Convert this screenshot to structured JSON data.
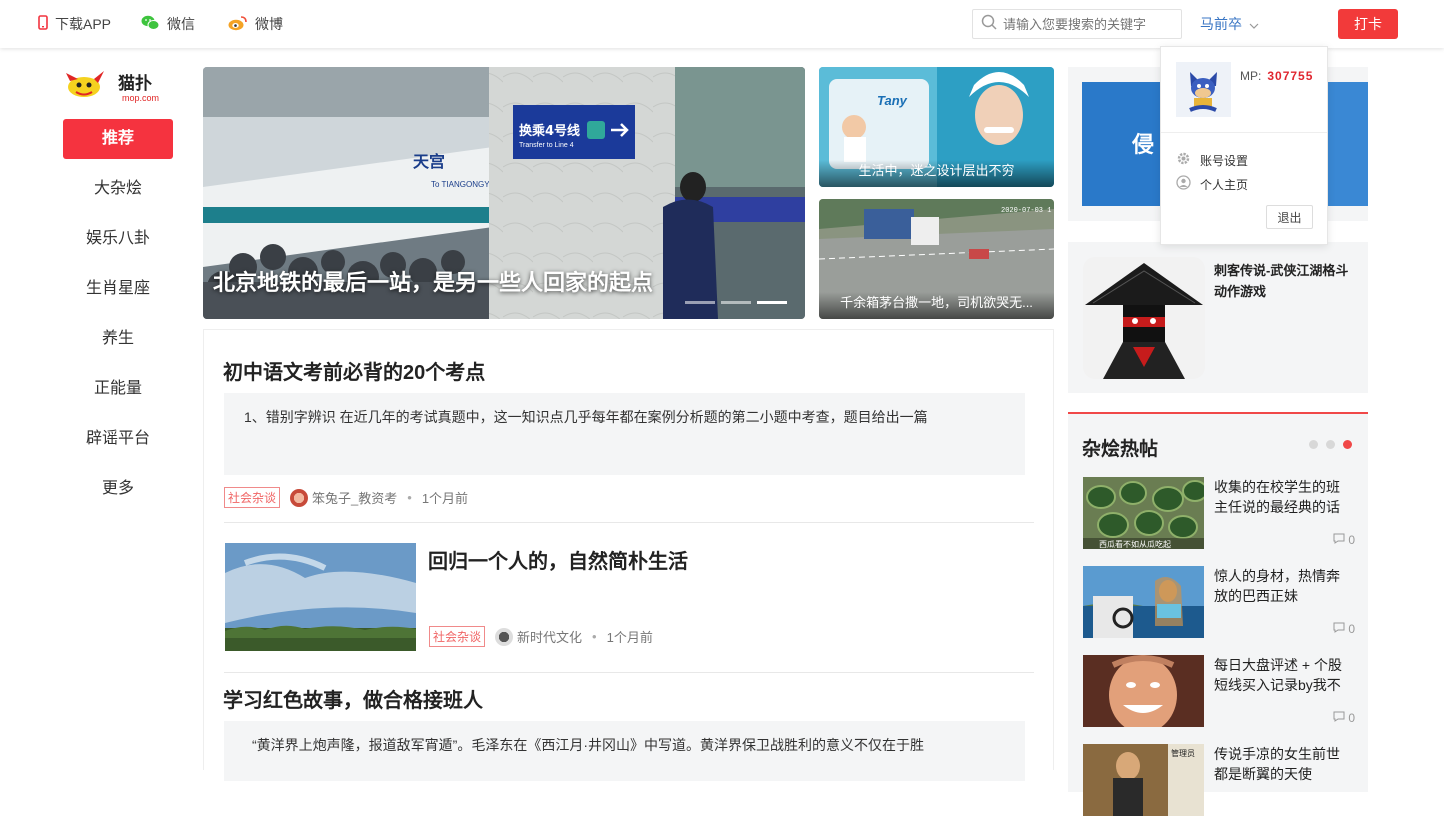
{
  "topbar": {
    "download_app": "下载APP",
    "wechat": "微信",
    "weibo": "微博",
    "search_placeholder": "请输入您要搜索的关键字",
    "username": "马前卒",
    "checkin_label": "打卡"
  },
  "sidebar": {
    "logo_text": "猫扑",
    "logo_sub": "mop.com",
    "items": [
      {
        "label": "推荐",
        "active": true
      },
      {
        "label": "大杂烩"
      },
      {
        "label": "娱乐八卦"
      },
      {
        "label": "生肖星座"
      },
      {
        "label": "养生"
      },
      {
        "label": "正能量"
      },
      {
        "label": "辟谣平台"
      },
      {
        "label": "更多"
      }
    ]
  },
  "hero": {
    "caption": "北京地铁的最后一站，是另一些人回家的起点",
    "sign_text": "换乘4号线",
    "sign_sub": "Transfer to Line 4",
    "station_text": "天宫",
    "station_sub": "To TIANGONGY",
    "slide_count": 3,
    "active_slide": 3
  },
  "side_cards": [
    {
      "caption": "生活中，迷之设计层出不穷"
    },
    {
      "caption": "千余箱茅台撒一地，司机欲哭无...",
      "stamp": "2020-07-03 1"
    }
  ],
  "feed": {
    "articles": [
      {
        "title": "初中语文考前必背的20个考点",
        "summary": "1、错别字辨识 在近几年的考试真题中，这一知识点几乎每年都在案例分析题的第二小题中考查，题目给出一篇",
        "tag": "社会杂谈",
        "author": "笨兔子_教资考",
        "time": "1个月前"
      },
      {
        "title": "回归一个人的，自然简朴生活",
        "tag": "社会杂谈",
        "author": "新时代文化",
        "time": "1个月前"
      },
      {
        "title": "学习红色故事，做合格接班人",
        "summary": "“黄洋界上炮声隆，报道敌军宵遁”。毛泽东在《西江月·井冈山》中写道。黄洋界保卫战胜利的意义不仅在于胜"
      }
    ]
  },
  "right": {
    "ad1_text": "侵",
    "game_title": "刺客传说-武侠江湖格斗动作游戏",
    "hot_title": "杂烩热帖",
    "hot_items": [
      {
        "title": "收集的在校学生的班主任说的最经典的话",
        "comments": "0",
        "overlay": "西瓜看不如从瓜吃起"
      },
      {
        "title": "惊人的身材，热情奔放的巴西正妹",
        "comments": "0"
      },
      {
        "title": "每日大盘评述 + 个股短线买入记录by我不",
        "comments": "0"
      },
      {
        "title": "传说手凉的女生前世都是断翼的天使",
        "comments": "",
        "overlay": "管理员"
      }
    ]
  },
  "dropdown": {
    "mp_label": "MP:",
    "mp_value": "307755",
    "account_settings": "账号设置",
    "profile": "个人主页",
    "logout": "退出"
  },
  "colors": {
    "accent": "#f5333f",
    "link": "#3a76c4",
    "tag": "#f06565"
  }
}
